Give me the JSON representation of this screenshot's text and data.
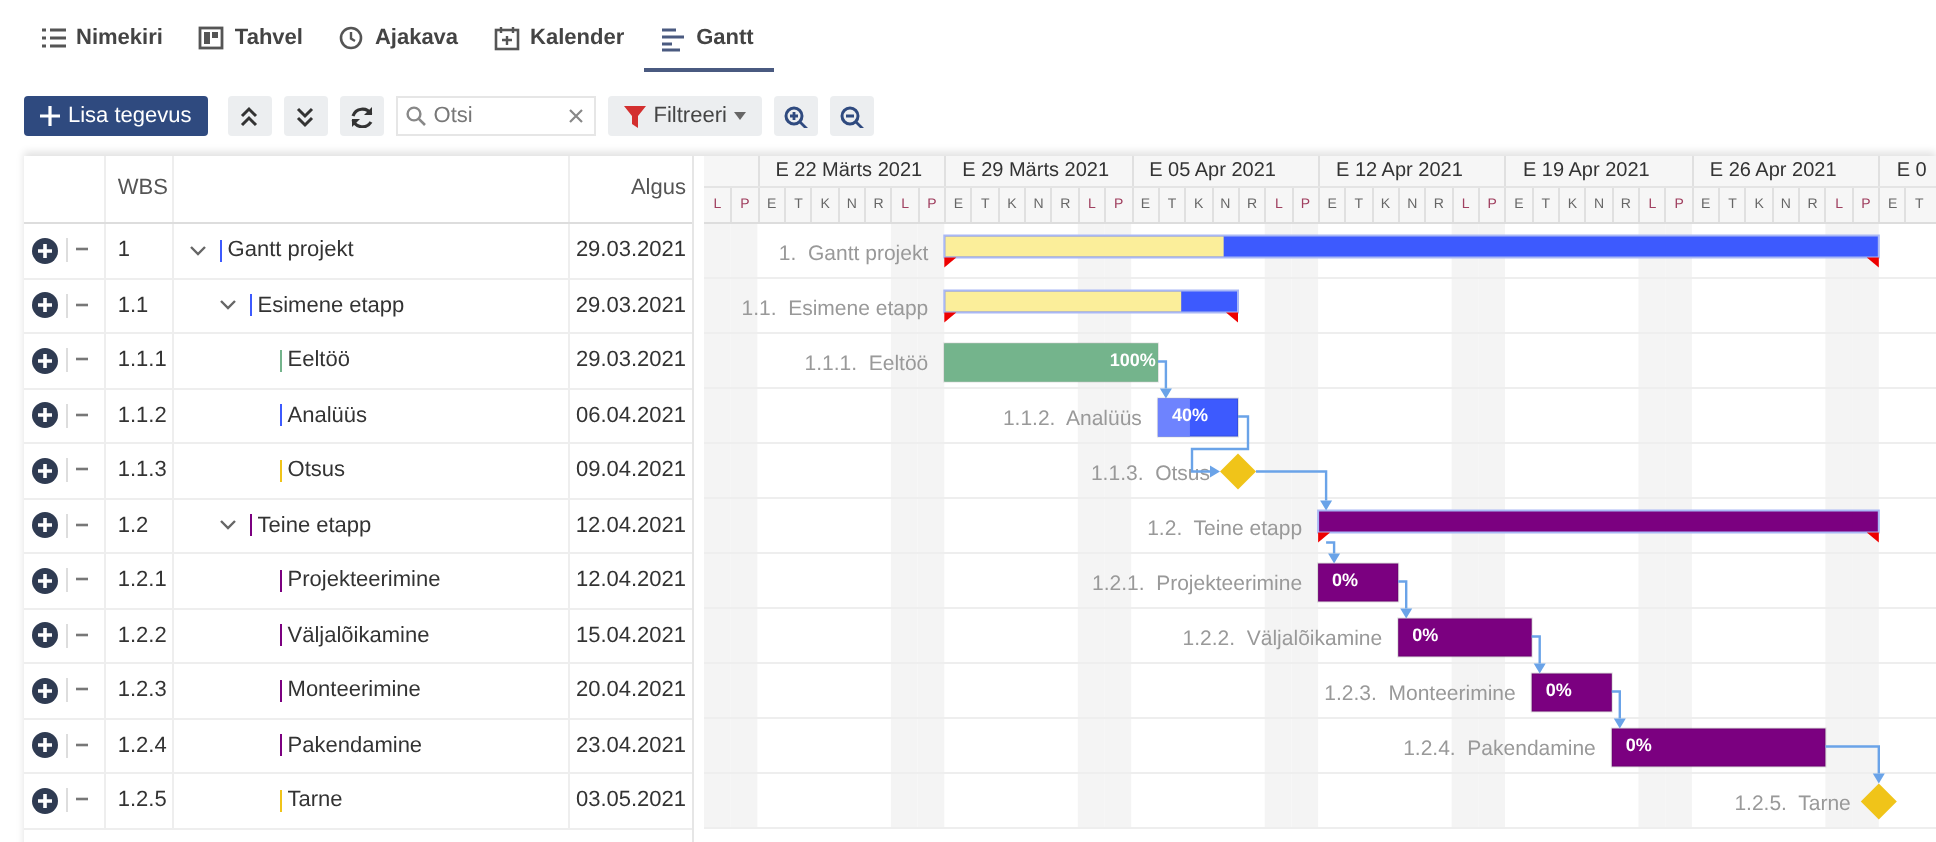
{
  "tabs": [
    {
      "label": "Nimekiri",
      "selected": false
    },
    {
      "label": "Tahvel",
      "selected": false
    },
    {
      "label": "Ajakava",
      "selected": false
    },
    {
      "label": "Kalender",
      "selected": false
    },
    {
      "label": "Gantt",
      "selected": true
    }
  ],
  "toolbar": {
    "add_button": "Lisa tegevus",
    "search": {
      "placeholder": "Otsi"
    },
    "filter_button": "Filtreeri"
  },
  "grid": {
    "columns": [
      "WBS",
      "Algus"
    ]
  },
  "timeline": {
    "weeks": [
      "E 22 Märts 2021",
      "E 29 Märts 2021",
      "E 05 Apr 2021",
      "E 12 Apr 2021",
      "E 19 Apr 2021",
      "E 26 Apr 2021",
      "E 0"
    ],
    "days": [
      {
        "letter": "L",
        "weekend": true
      },
      {
        "letter": "P",
        "weekend": true
      },
      {
        "letter": "E",
        "weekend": false
      },
      {
        "letter": "T",
        "weekend": false
      },
      {
        "letter": "K",
        "weekend": false
      },
      {
        "letter": "N",
        "weekend": false
      },
      {
        "letter": "R",
        "weekend": false
      },
      {
        "letter": "L",
        "weekend": true
      },
      {
        "letter": "P",
        "weekend": true
      },
      {
        "letter": "E",
        "weekend": false
      },
      {
        "letter": "T",
        "weekend": false
      },
      {
        "letter": "K",
        "weekend": false
      },
      {
        "letter": "N",
        "weekend": false
      },
      {
        "letter": "R",
        "weekend": false
      },
      {
        "letter": "L",
        "weekend": true
      },
      {
        "letter": "P",
        "weekend": true
      },
      {
        "letter": "E",
        "weekend": false
      },
      {
        "letter": "T",
        "weekend": false
      },
      {
        "letter": "K",
        "weekend": false
      },
      {
        "letter": "N",
        "weekend": false
      },
      {
        "letter": "R",
        "weekend": false
      },
      {
        "letter": "L",
        "weekend": true
      },
      {
        "letter": "P",
        "weekend": true
      },
      {
        "letter": "E",
        "weekend": false
      },
      {
        "letter": "T",
        "weekend": false
      },
      {
        "letter": "K",
        "weekend": false
      },
      {
        "letter": "N",
        "weekend": false
      },
      {
        "letter": "R",
        "weekend": false
      },
      {
        "letter": "L",
        "weekend": true
      },
      {
        "letter": "P",
        "weekend": true
      },
      {
        "letter": "E",
        "weekend": false
      },
      {
        "letter": "T",
        "weekend": false
      },
      {
        "letter": "K",
        "weekend": false
      },
      {
        "letter": "N",
        "weekend": false
      },
      {
        "letter": "R",
        "weekend": false
      },
      {
        "letter": "L",
        "weekend": true
      },
      {
        "letter": "P",
        "weekend": true
      },
      {
        "letter": "E",
        "weekend": false
      },
      {
        "letter": "T",
        "weekend": false
      },
      {
        "letter": "K",
        "weekend": false
      },
      {
        "letter": "N",
        "weekend": false
      },
      {
        "letter": "R",
        "weekend": false
      },
      {
        "letter": "L",
        "weekend": true
      },
      {
        "letter": "P",
        "weekend": true
      },
      {
        "letter": "E",
        "weekend": false
      },
      {
        "letter": "T",
        "weekend": false
      }
    ]
  },
  "tasks": [
    {
      "wbs": "1",
      "name": "Gantt projekt",
      "start": "29.03.2021",
      "kind": "summary",
      "expanded": true,
      "color": "#3d5afe",
      "level": 0.3,
      "chart_label": "1.  Gantt projekt",
      "children": [
        {
          "wbs": "1.1",
          "name": "Esimene etapp",
          "start": "29.03.2021",
          "kind": "summary",
          "expanded": true,
          "color": "#3d5afe",
          "level": 0.81,
          "chart_label": "1.1.  Esimene etapp",
          "children": [
            {
              "wbs": "1.1.1",
              "name": "Eeltöö",
              "start": "29.03.2021",
              "kind": "task",
              "color": "#74b48c",
              "level": 1,
              "progress_text": "100%",
              "chart_label": "1.1.1.  Eeltöö"
            },
            {
              "wbs": "1.1.2",
              "name": "Analüüs",
              "start": "06.04.2021",
              "kind": "task",
              "color": "#3d5afe",
              "level": 0.4,
              "progress_text": "40%",
              "chart_label": "1.1.2.  Analüüs"
            },
            {
              "wbs": "1.1.3",
              "name": "Otsus",
              "start": "09.04.2021",
              "kind": "milestone",
              "color": "#f0c419",
              "chart_label": "1.1.3.  Otsus"
            }
          ]
        },
        {
          "wbs": "1.2",
          "name": "Teine etapp",
          "start": "12.04.2021",
          "kind": "summary",
          "expanded": true,
          "color": "#7b0080",
          "chart_label": "1.2.  Teine etapp",
          "children": [
            {
              "wbs": "1.2.1",
              "name": "Projekteerimine",
              "start": "12.04.2021",
              "kind": "task",
              "color": "#7b0080",
              "progress_text": "0%",
              "chart_label": "1.2.1.  Projekteerimine"
            },
            {
              "wbs": "1.2.2",
              "name": "Väljalõikamine",
              "start": "15.04.2021",
              "kind": "task",
              "color": "#7b0080",
              "progress_text": "0%",
              "chart_label": "1.2.2.  Väljalõikamine"
            },
            {
              "wbs": "1.2.3",
              "name": "Monteerimine",
              "start": "20.04.2021",
              "kind": "task",
              "color": "#7b0080",
              "progress_text": "0%",
              "chart_label": "1.2.3.  Monteerimine"
            },
            {
              "wbs": "1.2.4",
              "name": "Pakendamine",
              "start": "23.04.2021",
              "kind": "task",
              "color": "#7b0080",
              "progress_text": "0%",
              "chart_label": "1.2.4.  Pakendamine"
            },
            {
              "wbs": "1.2.5",
              "name": "Tarne",
              "start": "03.05.2021",
              "kind": "milestone",
              "color": "#f0c419",
              "chart_label": "1.2.5.  Tarne"
            }
          ]
        }
      ]
    }
  ]
}
